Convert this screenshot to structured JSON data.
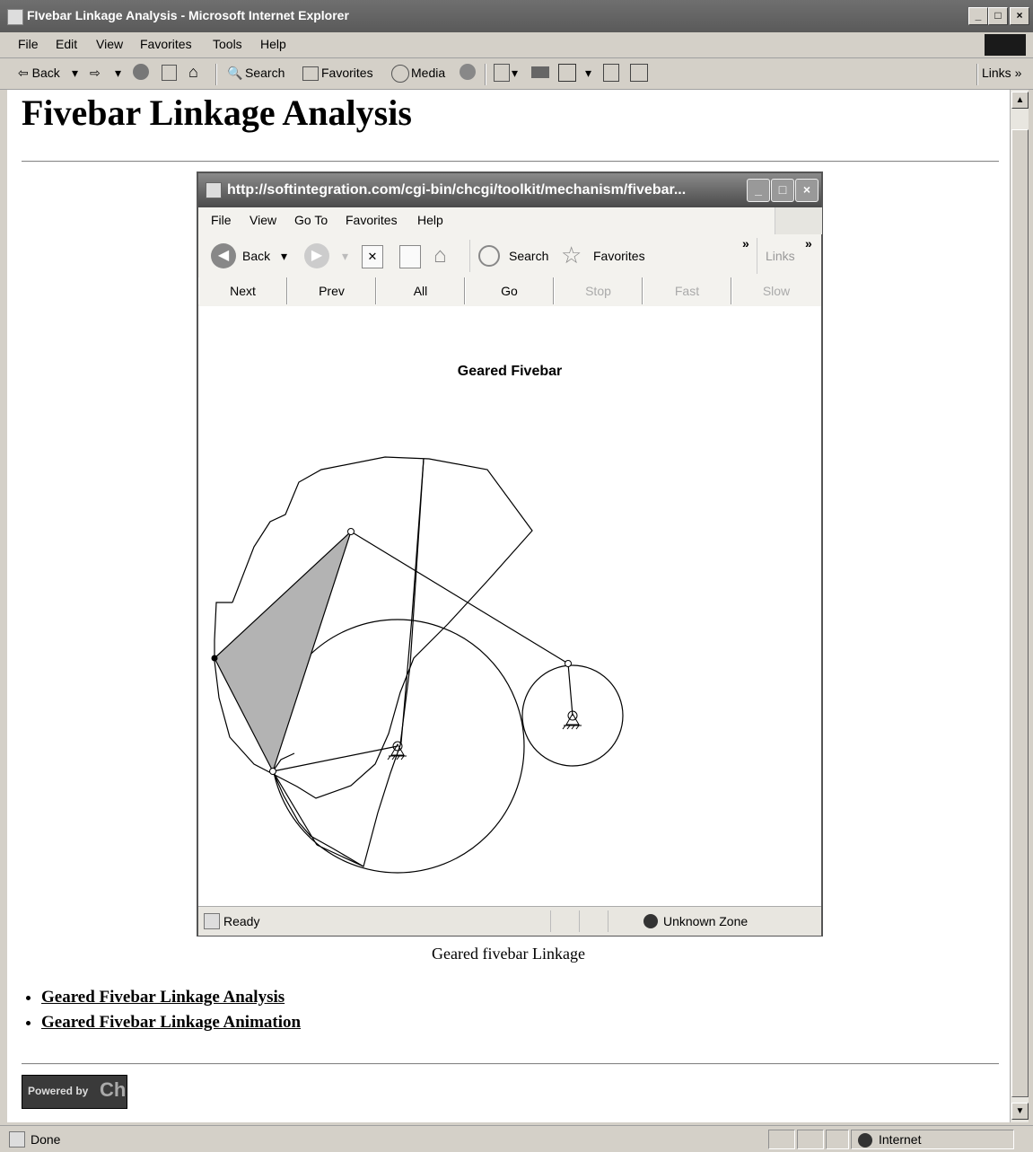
{
  "window": {
    "title": "FIvebar Linkage Analysis - Microsoft Internet Explorer",
    "min": "_",
    "max": "□",
    "close": "×"
  },
  "menu": [
    "File",
    "Edit",
    "View",
    "Favorites",
    "Tools",
    "Help"
  ],
  "toolbar": {
    "back": "⇦ Back",
    "forward": "⇨",
    "search": "Search",
    "favorites": "Favorites",
    "media": "Media",
    "links": "Links »"
  },
  "page": {
    "heading": "Fivebar Linkage Analysis",
    "caption": "Geared fivebar Linkage",
    "links": [
      "Geared Fivebar Linkage Analysis",
      "Geared Fivebar Linkage Animation"
    ],
    "badge_powered": "Powered by",
    "badge_logo": "Ch"
  },
  "inner": {
    "title": "http://softintegration.com/cgi-bin/chcgi/toolkit/mechanism/fivebar...",
    "menu": [
      "File",
      "View",
      "Go To",
      "Favorites",
      "Help"
    ],
    "toolbar": {
      "back": "Back",
      "search": "Search",
      "favorites": "Favorites",
      "links": "Links",
      "chevron": "»"
    },
    "nav": [
      {
        "label": "Next",
        "enabled": true
      },
      {
        "label": "Prev",
        "enabled": true
      },
      {
        "label": "All",
        "enabled": true
      },
      {
        "label": "Go",
        "enabled": true
      },
      {
        "label": "Stop",
        "enabled": false
      },
      {
        "label": "Fast",
        "enabled": false
      },
      {
        "label": "Slow",
        "enabled": false
      }
    ],
    "figure_title": "Geared Fivebar",
    "status": "Ready",
    "zone": "Unknown Zone"
  },
  "status": {
    "text": "Done",
    "zone": "Internet"
  }
}
